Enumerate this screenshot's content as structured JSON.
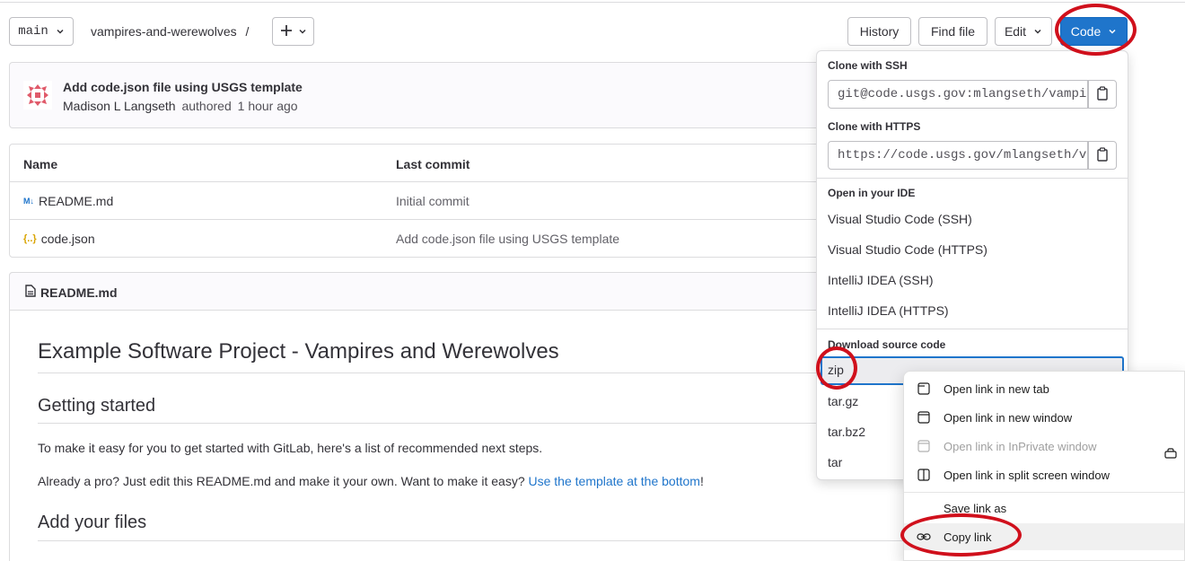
{
  "toolbar": {
    "branch": "main",
    "repo_path": "vampires-and-werewolves",
    "path_sep": "/",
    "plus_label": "+",
    "history": "History",
    "find_file": "Find file",
    "edit": "Edit",
    "code": "Code"
  },
  "commit": {
    "message": "Add code.json file using USGS template",
    "author": "Madison L Langseth",
    "authored": "authored",
    "time": "1 hour ago"
  },
  "file_table": {
    "headers": [
      "Name",
      "Last commit"
    ],
    "rows": [
      {
        "name": "README.md",
        "icon": "markdown-icon",
        "commit": "Initial commit"
      },
      {
        "name": "code.json",
        "icon": "json-icon",
        "commit": "Add code.json file using USGS template"
      }
    ]
  },
  "readme": {
    "file_label": "README.md",
    "h1": "Example Software Project - Vampires and Werewolves",
    "h2_getting_started": "Getting started",
    "p1": "To make it easy for you to get started with GitLab, here's a list of recommended next steps.",
    "p2_prefix": "Already a pro? Just edit this README.md and make it your own. Want to make it easy?",
    "p2_link": "Use the template at the bottom",
    "p2_suffix": "!",
    "h2_add_files": "Add your files"
  },
  "code_dropdown": {
    "clone_ssh_label": "Clone with SSH",
    "clone_ssh_value": "git@code.usgs.gov:mlangseth/vampires-and-werewolves.git",
    "clone_https_label": "Clone with HTTPS",
    "clone_https_value": "https://code.usgs.gov/mlangseth/vampires-and-werewolves.git",
    "ide_label": "Open in your IDE",
    "ide_items": [
      "Visual Studio Code (SSH)",
      "Visual Studio Code (HTTPS)",
      "IntelliJ IDEA (SSH)",
      "IntelliJ IDEA (HTTPS)"
    ],
    "download_label": "Download source code",
    "download_items": [
      "zip",
      "tar.gz",
      "tar.bz2",
      "tar"
    ]
  },
  "context_menu": {
    "items": [
      "Open link in new tab",
      "Open link in new window",
      "Open link in InPrivate window",
      "Open link in split screen window",
      "Save link as",
      "Copy link"
    ]
  },
  "colors": {
    "accent": "#1f75cb",
    "annotation_red": "#d0101c"
  }
}
